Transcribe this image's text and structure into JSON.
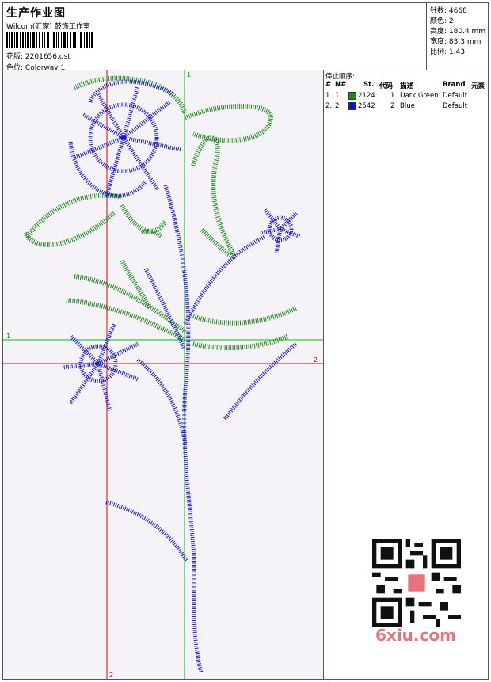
{
  "header": {
    "title": "生产作业图",
    "company": "Wilcom(汇家) 鼓饰工作室",
    "design_label": "花版:",
    "design_value": "2201656.dst",
    "colorway_label": "色位:",
    "colorway_value": "Colorway 1"
  },
  "stats": [
    {
      "label": "针数:",
      "value": "4668"
    },
    {
      "label": "颜色:",
      "value": "2"
    },
    {
      "label": "高度:",
      "value": "180.4 mm"
    },
    {
      "label": "宽度:",
      "value": "83.3 mm"
    },
    {
      "label": "比例:",
      "value": "1.43"
    }
  ],
  "stop_table": {
    "caption": "停止顺序:",
    "headers": [
      "#",
      "N#",
      "St.",
      "代码",
      "描述",
      "Brand",
      "元素"
    ],
    "rows": [
      {
        "index": "1.",
        "n": "1",
        "st": "2124",
        "code": "1",
        "desc": "Dark Green",
        "brand": "Default",
        "color": "#1a8a1a"
      },
      {
        "index": "2.",
        "n": "2",
        "st": "2542",
        "code": "2",
        "desc": "Blue",
        "brand": "Default",
        "color": "#1010e0"
      }
    ]
  },
  "axes": {
    "green_label_top": "1",
    "green_label_left": "1",
    "red_label_right": "2",
    "red_label_bottom": "2"
  },
  "watermark": "6xiu.com",
  "colors": {
    "green_thread": "#1a8a1a",
    "blue_thread": "#1414d8",
    "red_axis": "#e00000",
    "green_axis": "#00c000"
  }
}
